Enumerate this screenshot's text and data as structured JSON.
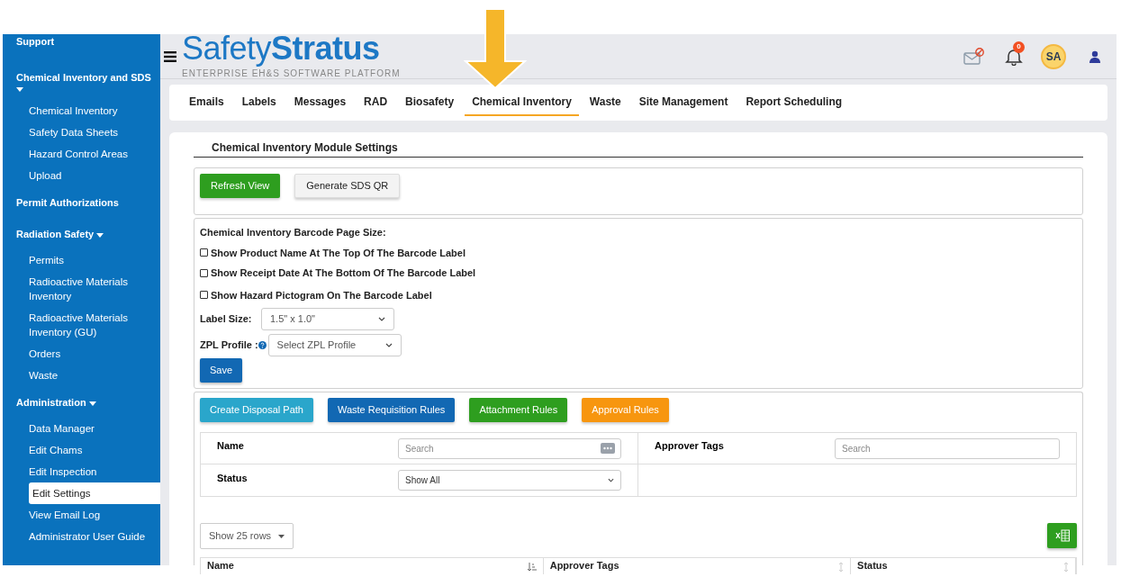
{
  "header": {
    "logo": "Safety**Stratus**",
    "tagline": "ENTERPRISE EH&S SOFTWARE PLATFORM",
    "notification_count": "0",
    "avatar_initials": "SA"
  },
  "sidebar": {
    "items": [
      {
        "kind": "section",
        "label": "Support",
        "selected": false
      },
      {
        "kind": "section",
        "label": "Chemical Inventory and SDS",
        "selected": false,
        "expanded": true
      },
      {
        "kind": "item",
        "label": "Chemical Inventory",
        "selected": false
      },
      {
        "kind": "item",
        "label": "Safety Data Sheets",
        "selected": false
      },
      {
        "kind": "item",
        "label": "Hazard Control Areas",
        "selected": false
      },
      {
        "kind": "item",
        "label": "Upload",
        "selected": false
      },
      {
        "kind": "section",
        "label": "Permit Authorizations",
        "selected": false
      },
      {
        "kind": "section",
        "label": "Radiation Safety",
        "selected": false,
        "expanded": true
      },
      {
        "kind": "item",
        "label": "Permits",
        "selected": false
      },
      {
        "kind": "item",
        "label": "Radioactive Materials Inventory",
        "selected": false
      },
      {
        "kind": "item",
        "label": "Radioactive Materials Inventory (GU)",
        "selected": false
      },
      {
        "kind": "item",
        "label": "Orders",
        "selected": false
      },
      {
        "kind": "item",
        "label": "Waste",
        "selected": false
      },
      {
        "kind": "section",
        "label": "Administration",
        "selected": false,
        "expanded": true
      },
      {
        "kind": "item",
        "label": "Data Manager",
        "selected": false
      },
      {
        "kind": "item",
        "label": "Edit Chams",
        "selected": false
      },
      {
        "kind": "item",
        "label": "Edit Inspection",
        "selected": false
      },
      {
        "kind": "item",
        "label": "Edit Settings",
        "selected": true
      },
      {
        "kind": "item",
        "label": "View Email Log",
        "selected": false
      },
      {
        "kind": "item",
        "label": "Administrator User Guide",
        "selected": false
      }
    ]
  },
  "tabs": [
    {
      "label": "Emails",
      "selected": false
    },
    {
      "label": "Labels",
      "selected": false
    },
    {
      "label": "Messages",
      "selected": false
    },
    {
      "label": "RAD",
      "selected": false
    },
    {
      "label": "Biosafety",
      "selected": false
    },
    {
      "label": "Chemical Inventory",
      "selected": true
    },
    {
      "label": "Waste",
      "selected": false
    },
    {
      "label": "Site Management",
      "selected": false
    },
    {
      "label": "Report Scheduling",
      "selected": false
    }
  ],
  "settings": {
    "title": "Chemical Inventory Module Settings",
    "actions": [
      {
        "label": "Refresh View",
        "kind": "success"
      },
      {
        "label": "Generate SDS QR",
        "kind": "default"
      }
    ],
    "barcode": {
      "heading": "Chemical Inventory Barcode Page Size:",
      "options": [
        {
          "label": "Show Product Name At The Top Of The Barcode Label",
          "checked": false
        },
        {
          "label": "Show Receipt Date At The Bottom Of The Barcode Label",
          "checked": false
        },
        {
          "label": "Show Hazard Pictogram On The Barcode Label",
          "checked": false
        }
      ],
      "label_size": {
        "label": "Label Size:",
        "value": "1.5\" x 1.0\""
      },
      "zpl_profile": {
        "label": "ZPL Profile :",
        "value": "Select ZPL Profile"
      },
      "save": "Save"
    },
    "rules": {
      "buttons": [
        {
          "label": "Create Disposal Path",
          "kind": "info"
        },
        {
          "label": "Waste Requisition Rules",
          "kind": "primary"
        },
        {
          "label": "Attachment Rules",
          "kind": "success"
        },
        {
          "label": "Approval Rules",
          "kind": "warning"
        }
      ],
      "filters": {
        "name": {
          "label": "Name",
          "placeholder": "Search"
        },
        "approver_tags": {
          "label": "Approver Tags",
          "placeholder": "Search"
        },
        "status": {
          "label": "Status",
          "value": "Show All"
        }
      },
      "page_length": "Show 25 rows",
      "table": {
        "columns": [
          {
            "label": "Name",
            "sorted": true
          },
          {
            "label": "Approver Tags",
            "sorted": false
          },
          {
            "label": "Status",
            "sorted": false
          }
        ]
      }
    }
  }
}
